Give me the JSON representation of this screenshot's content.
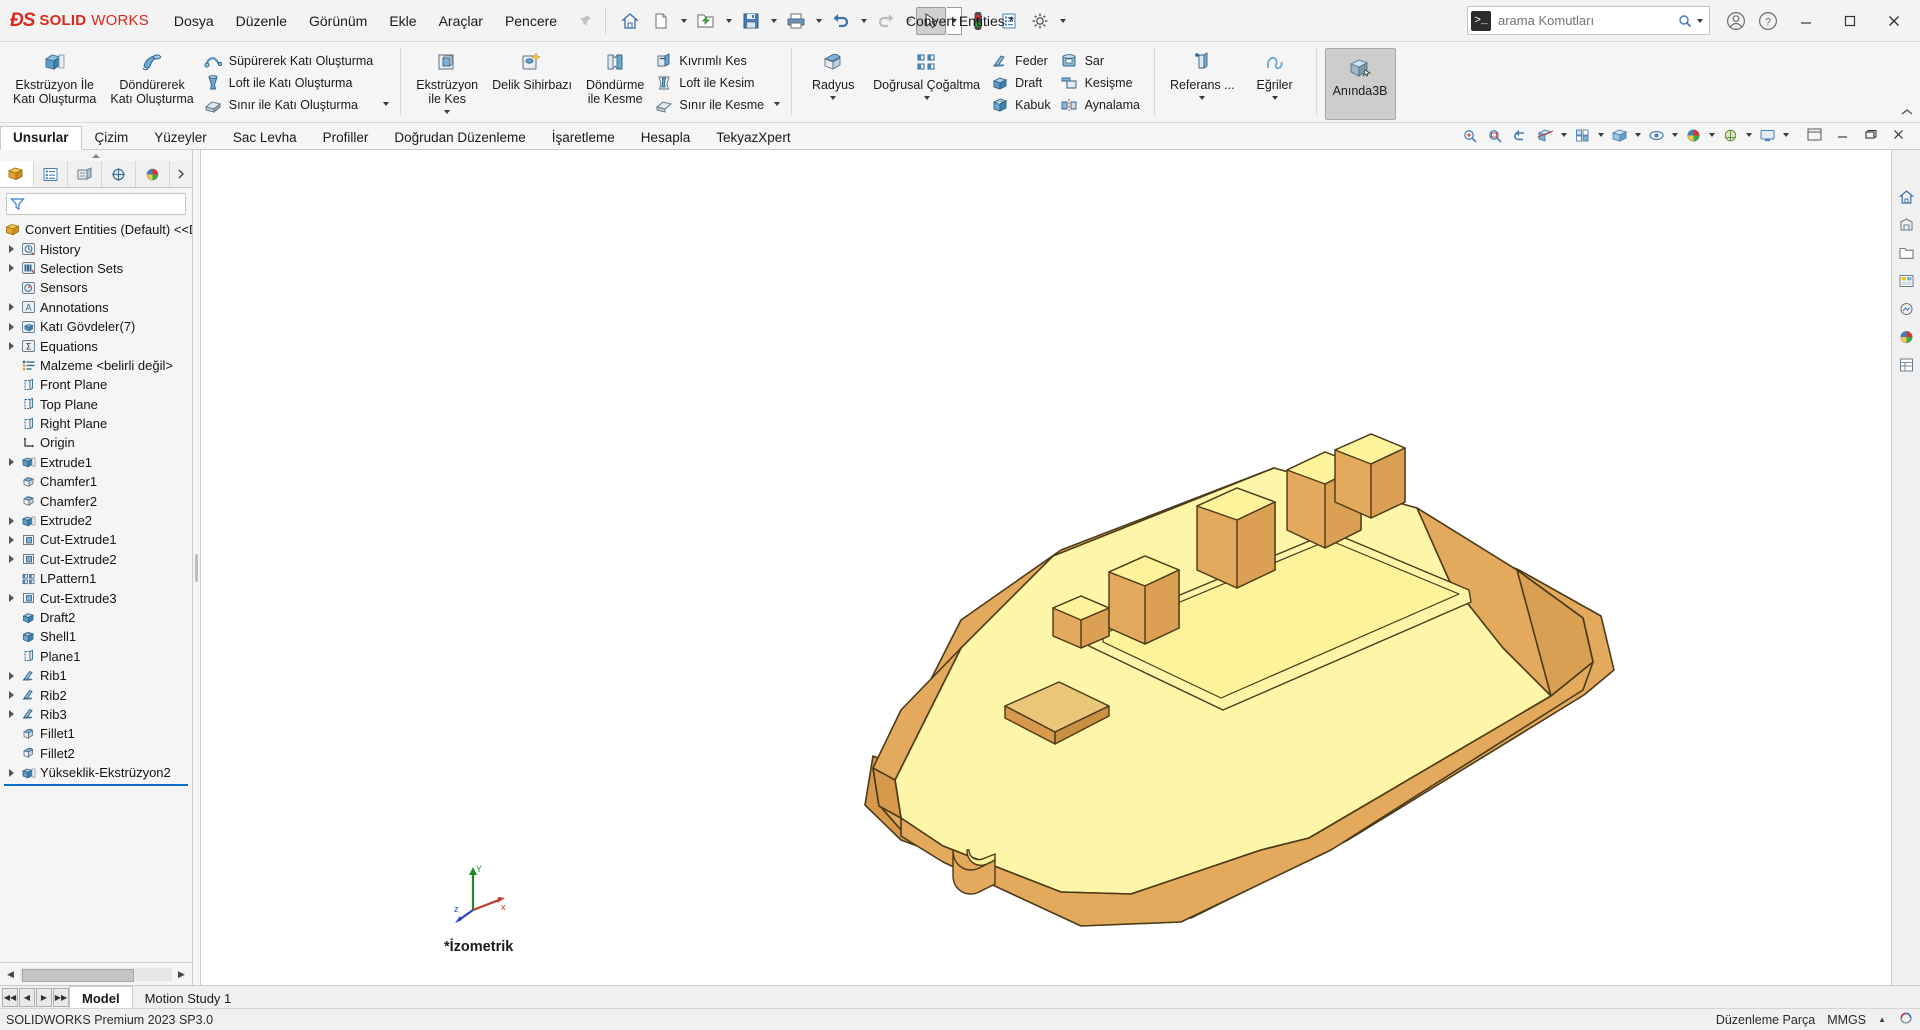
{
  "app": {
    "brand_ds": "ĐS",
    "brand_solid": "SOLID",
    "brand_works": "WORKS",
    "document_title": "Convert Entities *",
    "accent_red": "#d62b1f"
  },
  "menu": {
    "items": [
      {
        "label": "Dosya"
      },
      {
        "label": "Düzenle"
      },
      {
        "label": "Görünüm"
      },
      {
        "label": "Ekle"
      },
      {
        "label": "Araçlar"
      },
      {
        "label": "Pencere"
      }
    ],
    "pin_icon": "pin-icon"
  },
  "quick_access": {
    "buttons": [
      {
        "name": "home-icon",
        "has_caret": false
      },
      {
        "name": "new-document-icon",
        "has_caret": true
      },
      {
        "name": "open-folder-icon",
        "has_caret": true
      },
      {
        "name": "save-icon",
        "has_caret": true
      },
      {
        "name": "print-icon",
        "has_caret": true
      },
      {
        "name": "undo-icon",
        "has_caret": true
      },
      {
        "name": "redo-icon",
        "has_caret": true,
        "disabled": true
      },
      {
        "name": "select-cursor-icon",
        "has_caret": true,
        "selected": true
      },
      {
        "name": "rebuild-traffic-light-icon",
        "has_caret": false
      },
      {
        "name": "document-properties-icon",
        "has_caret": false
      },
      {
        "name": "options-gear-icon",
        "has_caret": true
      }
    ]
  },
  "search": {
    "placeholder": "arama Komutları",
    "command_icon": "command-prompt-icon",
    "magnifier_icon": "search-icon",
    "dropdown_icon": "chevron-down-icon"
  },
  "title_right_icons": [
    {
      "name": "user-account-icon"
    },
    {
      "name": "help-icon"
    }
  ],
  "window_controls": [
    {
      "name": "minimize-button"
    },
    {
      "name": "maximize-button"
    },
    {
      "name": "close-button"
    }
  ],
  "ribbon": {
    "groups": [
      {
        "name": "features-solid",
        "big": [
          {
            "label": "Ekstrüzyon İle\nKatı Oluşturma",
            "icon": "extrude-boss-icon",
            "caret": false
          },
          {
            "label": "Döndürerek\nKatı Oluşturma",
            "icon": "revolve-boss-icon",
            "caret": false
          }
        ],
        "small": [
          {
            "label": "Süpürerek Katı Oluşturma",
            "icon": "swept-boss-icon"
          },
          {
            "label": "Loft ile Katı Oluşturma",
            "icon": "lofted-boss-icon"
          },
          {
            "label": "Sınır ile Katı Oluşturma",
            "icon": "boundary-boss-icon"
          }
        ]
      },
      {
        "name": "features-cut",
        "big": [
          {
            "label": "Ekstrüzyon\nile Kes",
            "icon": "extruded-cut-icon",
            "caret": true
          },
          {
            "label": "Delik Sihirbazı",
            "icon": "hole-wizard-icon",
            "caret": false
          },
          {
            "label": "Döndürme\nile Kesme",
            "icon": "revolved-cut-icon",
            "caret": false
          }
        ],
        "small": [
          {
            "label": "Kıvrımlı Kes",
            "icon": "swept-cut-icon"
          },
          {
            "label": "Loft ile Kesim",
            "icon": "lofted-cut-icon"
          },
          {
            "label": "Sınır ile Kesme",
            "icon": "boundary-cut-icon"
          }
        ]
      },
      {
        "name": "features-modify",
        "big": [
          {
            "label": "Radyus",
            "icon": "fillet-icon",
            "caret": true
          },
          {
            "label": "Doğrusal Çoğaltma",
            "icon": "linear-pattern-icon",
            "caret": true
          }
        ],
        "small": [
          {
            "label": "Feder",
            "icon": "rib-icon"
          },
          {
            "label": "Draft",
            "icon": "draft-icon"
          },
          {
            "label": "Kabuk",
            "icon": "shell-icon"
          }
        ],
        "small2": [
          {
            "label": "Sar",
            "icon": "wrap-icon"
          },
          {
            "label": "Kesişme",
            "icon": "intersect-icon"
          },
          {
            "label": "Aynalama",
            "icon": "mirror-icon"
          }
        ]
      },
      {
        "name": "reference-geometry",
        "big": [
          {
            "label": "Referans ...",
            "icon": "reference-geometry-icon",
            "caret": true
          },
          {
            "label": "Eğriler",
            "icon": "curves-icon",
            "caret": true
          }
        ]
      },
      {
        "name": "instant3d",
        "big": [
          {
            "label": "Anında3B",
            "icon": "instant3d-icon",
            "caret": false,
            "active": true
          }
        ]
      }
    ]
  },
  "command_tabs": {
    "items": [
      {
        "label": "Unsurlar",
        "active": true
      },
      {
        "label": "Çizim",
        "active": false
      },
      {
        "label": "Yüzeyler",
        "active": false
      },
      {
        "label": "Sac Levha",
        "active": false
      },
      {
        "label": "Profiller",
        "active": false
      },
      {
        "label": "Doğrudan Düzenleme",
        "active": false
      },
      {
        "label": "İşaretleme",
        "active": false
      },
      {
        "label": "Hesapla",
        "active": false
      },
      {
        "label": "TekyazXpert",
        "active": false
      }
    ],
    "view_tools": [
      {
        "name": "zoom-to-fit-icon",
        "caret": false
      },
      {
        "name": "zoom-to-area-icon",
        "caret": false
      },
      {
        "name": "previous-view-icon",
        "caret": false
      },
      {
        "name": "section-view-icon",
        "caret": false
      },
      {
        "name": "view-orientation-icon",
        "caret": true
      },
      {
        "name": "display-style-icon",
        "caret": true
      },
      {
        "name": "hide-show-items-icon",
        "caret": true
      },
      {
        "name": "appearances-icon",
        "caret": true
      },
      {
        "name": "scene-icon",
        "caret": true
      },
      {
        "name": "view-settings-icon",
        "caret": true
      }
    ],
    "window_tools": [
      {
        "name": "tile-windows-icon"
      },
      {
        "name": "minimize-doc-button"
      },
      {
        "name": "restore-doc-button"
      },
      {
        "name": "close-doc-button"
      }
    ]
  },
  "feature_manager": {
    "tabs": [
      {
        "name": "feature-manager-tab",
        "icon": "feature-tree-icon",
        "active": true
      },
      {
        "name": "property-manager-tab",
        "icon": "property-manager-icon",
        "active": false
      },
      {
        "name": "configuration-manager-tab",
        "icon": "configuration-icon",
        "active": false
      },
      {
        "name": "dimxpert-manager-tab",
        "icon": "dimxpert-icon",
        "active": false
      },
      {
        "name": "display-manager-tab",
        "icon": "display-manager-icon",
        "active": false
      }
    ],
    "more_icon": "chevron-right-icon",
    "filter_icon": "filter-icon",
    "filter_value": "",
    "root": {
      "label": "Convert Entities (Default) <<D",
      "icon": "part-icon"
    },
    "items": [
      {
        "label": "History",
        "icon": "history-icon",
        "expandable": true,
        "indent": 1
      },
      {
        "label": "Selection Sets",
        "icon": "selection-sets-icon",
        "expandable": true,
        "indent": 1
      },
      {
        "label": "Sensors",
        "icon": "sensors-icon",
        "expandable": false,
        "indent": 1
      },
      {
        "label": "Annotations",
        "icon": "annotations-icon",
        "expandable": true,
        "indent": 1
      },
      {
        "label": "Katı Gövdeler(7)",
        "icon": "solid-bodies-icon",
        "expandable": true,
        "indent": 1
      },
      {
        "label": "Equations",
        "icon": "equations-icon",
        "expandable": true,
        "indent": 1
      },
      {
        "label": "Malzeme <belirli değil>",
        "icon": "material-icon",
        "expandable": false,
        "indent": 1
      },
      {
        "label": "Front Plane",
        "icon": "plane-icon",
        "expandable": false,
        "indent": 1
      },
      {
        "label": "Top Plane",
        "icon": "plane-icon",
        "expandable": false,
        "indent": 1
      },
      {
        "label": "Right Plane",
        "icon": "plane-icon",
        "expandable": false,
        "indent": 1
      },
      {
        "label": "Origin",
        "icon": "origin-icon",
        "expandable": false,
        "indent": 1
      },
      {
        "label": "Extrude1",
        "icon": "extrude-icon",
        "expandable": true,
        "indent": 1
      },
      {
        "label": "Chamfer1",
        "icon": "chamfer-icon",
        "expandable": false,
        "indent": 1
      },
      {
        "label": "Chamfer2",
        "icon": "chamfer-icon",
        "expandable": false,
        "indent": 1
      },
      {
        "label": "Extrude2",
        "icon": "extrude-icon",
        "expandable": true,
        "indent": 1
      },
      {
        "label": "Cut-Extrude1",
        "icon": "cut-extrude-icon",
        "expandable": true,
        "indent": 1
      },
      {
        "label": "Cut-Extrude2",
        "icon": "cut-extrude-icon",
        "expandable": true,
        "indent": 1
      },
      {
        "label": "LPattern1",
        "icon": "linear-pattern-icon",
        "expandable": false,
        "indent": 1
      },
      {
        "label": "Cut-Extrude3",
        "icon": "cut-extrude-icon",
        "expandable": true,
        "indent": 1
      },
      {
        "label": "Draft2",
        "icon": "draft-icon",
        "expandable": false,
        "indent": 1
      },
      {
        "label": "Shell1",
        "icon": "shell-icon",
        "expandable": false,
        "indent": 1
      },
      {
        "label": "Plane1",
        "icon": "plane-icon",
        "expandable": false,
        "indent": 1
      },
      {
        "label": "Rib1",
        "icon": "rib-icon",
        "expandable": true,
        "indent": 1
      },
      {
        "label": "Rib2",
        "icon": "rib-icon",
        "expandable": true,
        "indent": 1
      },
      {
        "label": "Rib3",
        "icon": "rib-icon",
        "expandable": true,
        "indent": 1
      },
      {
        "label": "Fillet1",
        "icon": "fillet-icon",
        "expandable": false,
        "indent": 1
      },
      {
        "label": "Fillet2",
        "icon": "fillet-icon",
        "expandable": false,
        "indent": 1
      },
      {
        "label": "Yükseklik-Ekstrüzyon2",
        "icon": "extrude-icon",
        "expandable": true,
        "indent": 1
      }
    ]
  },
  "graphics": {
    "view_label": "*İzometrik",
    "triad": {
      "x_label": "x",
      "y_label": "Y",
      "z_label": "z"
    },
    "model_colors": {
      "face_light": "#fdf6a8",
      "face_top": "#fcf39a",
      "face_side": "#e0a85a",
      "face_dark": "#d29a4f",
      "edge": "#4a3a18"
    }
  },
  "right_toolbar": [
    {
      "name": "view-home-icon"
    },
    {
      "name": "view-scene-icon"
    },
    {
      "name": "view-folder-icon"
    },
    {
      "name": "view-palette-icon"
    },
    {
      "name": "view-decals-icon"
    },
    {
      "name": "view-appearances-icon"
    },
    {
      "name": "view-custom-properties-icon"
    }
  ],
  "bottom_tabs": {
    "nav": [
      {
        "name": "first-tab-button",
        "glyph": "◀◀"
      },
      {
        "name": "prev-tab-button",
        "glyph": "◀"
      },
      {
        "name": "next-tab-button",
        "glyph": "▶"
      },
      {
        "name": "last-tab-button",
        "glyph": "▶▶"
      }
    ],
    "tabs": [
      {
        "label": "Model",
        "active": true
      },
      {
        "label": "Motion Study 1",
        "active": false
      }
    ]
  },
  "status_bar": {
    "left": "SOLIDWORKS Premium 2023 SP3.0",
    "edit_state": "Düzenleme Parça",
    "units": "MMGS",
    "units_caret": "▲",
    "sync_icon": "sync-icon"
  }
}
